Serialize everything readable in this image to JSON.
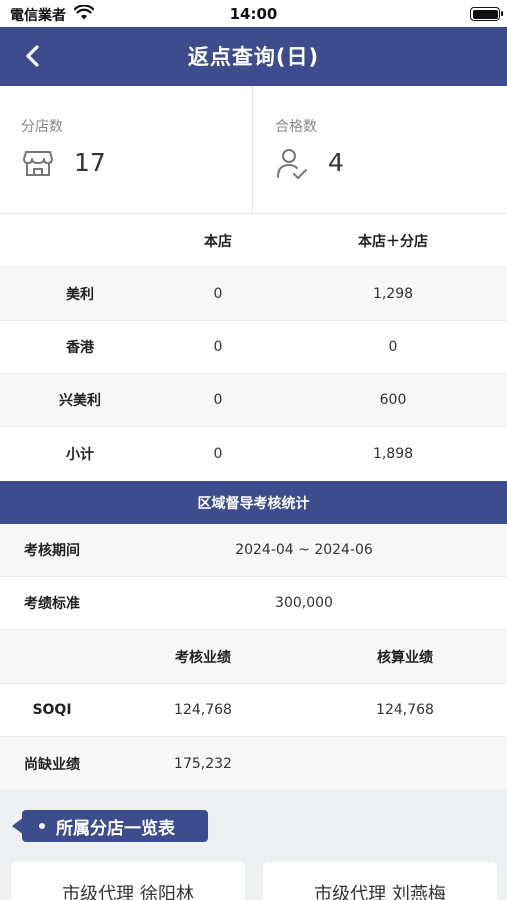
{
  "status_bar": {
    "carrier": "電信業者",
    "time": "14:00"
  },
  "nav": {
    "title": "返点查询(日)"
  },
  "summary": {
    "branches": {
      "label": "分店数",
      "value": "17",
      "icon": "store-icon"
    },
    "qualified": {
      "label": "合格数",
      "value": "4",
      "icon": "user-check-icon"
    }
  },
  "rebate_table": {
    "headers": [
      "本店",
      "本店＋分店"
    ],
    "rows": [
      {
        "name": "美利",
        "store": "0",
        "total": "1,298"
      },
      {
        "name": "香港",
        "store": "0",
        "total": "0"
      },
      {
        "name": "兴美利",
        "store": "0",
        "total": "600"
      },
      {
        "name": "小计",
        "store": "0",
        "total": "1,898"
      }
    ]
  },
  "region": {
    "title": "区域督导考核统计",
    "period_label": "考核期间",
    "period_value": "2024-04 ~ 2024-06",
    "standard_label": "考绩标准",
    "standard_value": "300,000",
    "headers": [
      "考核业绩",
      "核算业绩"
    ],
    "soqi": {
      "label": "SOQI",
      "assessed": "124,768",
      "accounted": "124,768"
    },
    "shortfall": {
      "label": "尚缺业绩",
      "value": "175,232"
    }
  },
  "branch_list": {
    "title": "所属分店一览表",
    "cards": [
      "市级代理 徐阳林",
      "市级代理 刘燕梅"
    ]
  },
  "colors": {
    "primary": "#3c4c8c",
    "row_alt": "#f7f7f7",
    "list_bg": "#eeeff1"
  }
}
